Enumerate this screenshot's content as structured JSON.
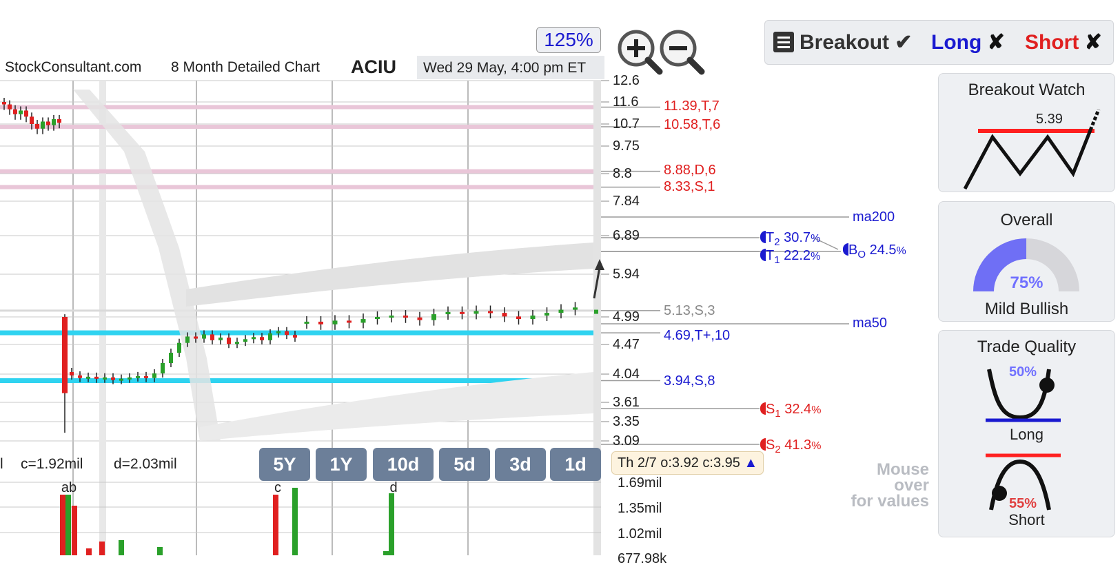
{
  "zoom": "125%",
  "header": {
    "site": "StockConsultant.com",
    "chart_name": "8 Month Detailed Chart",
    "symbol": "ACIU",
    "datetime": "Wed 29 May, 4:00 pm ET"
  },
  "toggles": {
    "breakout": "Breakout",
    "breakout_mark": "✔",
    "long": "Long",
    "long_mark": "✘",
    "short": "Short",
    "short_mark": "✘"
  },
  "panels": {
    "breakout_watch": {
      "title": "Breakout Watch",
      "value": "5.39"
    },
    "overall": {
      "title": "Overall",
      "percent": "75%",
      "percent_value": 0.75,
      "verdict": "Mild Bullish"
    },
    "trade_quality": {
      "title": "Trade Quality",
      "long_pct": "50%",
      "long_label": "Long",
      "short_pct": "55%",
      "short_label": "Short"
    }
  },
  "chart_data": {
    "type": "candlestick",
    "price_axis": [
      "12.6",
      "11.6",
      "10.7",
      "9.75",
      "8.8",
      "7.84",
      "6.89",
      "5.94",
      "4.99",
      "4.47",
      "4.04",
      "3.61",
      "3.35",
      "3.09"
    ],
    "levels": [
      {
        "label": "11.39,T,7",
        "price": 11.39,
        "color": "#e02020",
        "band": "#e9c6d8"
      },
      {
        "label": "10.58,T,6",
        "price": 10.58,
        "color": "#e02020",
        "band": "#e9c6d8"
      },
      {
        "label": "8.88,D,6",
        "price": 8.88,
        "color": "#e02020",
        "band": "#e9c6d8"
      },
      {
        "label": "8.33,S,1",
        "price": 8.33,
        "color": "#e02020",
        "band": "#e9c6d8"
      },
      {
        "label": "5.13,S,3",
        "price": 5.13,
        "color": "#8a8a8a",
        "band": "#d9d9d9"
      },
      {
        "label": "4.69,T+,10",
        "price": 4.69,
        "color": "#1a1ad0",
        "band": "#2fd3f0"
      },
      {
        "label": "3.94,S,8",
        "price": 3.94,
        "color": "#1a1ad0",
        "band": "#2fd3f0"
      }
    ],
    "moving_averages": [
      {
        "label": "ma200"
      },
      {
        "label": "ma50"
      }
    ],
    "targets": [
      {
        "name": "T",
        "sub": "2",
        "pct": "30.7",
        "unit": "%"
      },
      {
        "name": "T",
        "sub": "1",
        "pct": "22.2",
        "unit": "%"
      },
      {
        "name": "B",
        "sub": "O",
        "pct": "24.5",
        "unit": "%"
      }
    ],
    "stops": [
      {
        "name": "S",
        "sub": "1",
        "pct": "32.4",
        "unit": "%"
      },
      {
        "name": "S",
        "sub": "2",
        "pct": "41.3",
        "unit": "%"
      }
    ],
    "candles_recent": [
      4.9,
      4.85,
      4.92,
      4.88,
      4.95,
      4.99,
      5.02,
      4.98,
      4.93,
      5.05,
      5.1,
      5.06,
      5.12,
      5.08,
      5.0,
      4.95,
      5.02,
      5.08,
      5.15,
      5.2
    ],
    "volume_axis": [
      "1.69mil",
      "1.35mil",
      "1.02mil",
      "677.98k"
    ],
    "volume_markers": [
      "ab",
      "c",
      "d"
    ]
  },
  "volume_summary": {
    "left_cut": "l",
    "c": "c=1.92mil",
    "d": "d=2.03mil"
  },
  "range_buttons": [
    "5Y",
    "1Y",
    "10d",
    "5d",
    "3d",
    "1d"
  ],
  "info": {
    "text": "Th 2/7 o:3.92 c:3.95",
    "arrow": "▲"
  },
  "hint": {
    "line1": "Mouse",
    "line2": "over",
    "line3": "for values"
  }
}
